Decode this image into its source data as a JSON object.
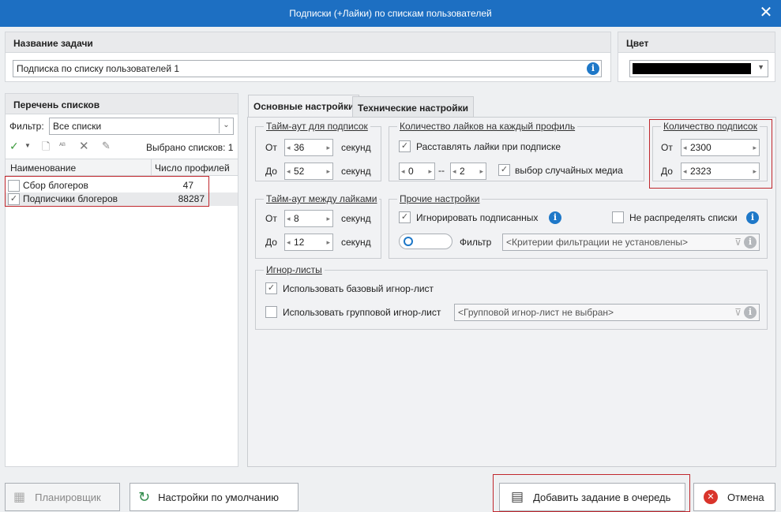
{
  "window": {
    "title": "Подписки (+Лайки) по спискам пользователей"
  },
  "task": {
    "header": "Название задачи",
    "name_value": "Подписка по списку пользователей 1"
  },
  "color": {
    "header": "Цвет",
    "value_color": "#000000"
  },
  "lists": {
    "header": "Перечень списков",
    "filter_label": "Фильтр:",
    "filter_value": "Все списки",
    "selected_label": "Выбрано списков: 1",
    "col_name": "Наименование",
    "col_count": "Число профилей",
    "rows": [
      {
        "name": "Сбор блогеров",
        "count": "47",
        "checked": false
      },
      {
        "name": "Подписчики блогеров",
        "count": "88287",
        "checked": true
      }
    ]
  },
  "tabs": [
    "Основные настройки",
    "Технические настройки"
  ],
  "timeout_subs": {
    "title": "Тайм-аут для подписок",
    "from_label": "От",
    "from_value": "36",
    "to_label": "До",
    "to_value": "52",
    "unit": "секунд"
  },
  "likes": {
    "title": "Количество лайков на каждый профиль",
    "place_likes": "Расставлять лайки при подписке",
    "from_value": "0",
    "dash": "--",
    "to_value": "2",
    "random_media": "выбор случайных медиа"
  },
  "subs_count": {
    "title": "Количество подписок",
    "from_label": "От",
    "from_value": "2300",
    "to_label": "До",
    "to_value": "2323"
  },
  "timeout_likes": {
    "title": "Тайм-аут между лайками",
    "from_label": "От",
    "from_value": "8",
    "to_label": "До",
    "to_value": "12",
    "unit": "секунд"
  },
  "other": {
    "title": "Прочие настройки",
    "ignore_subscribed": "Игнорировать подписанных",
    "no_distribute": "Не распределять списки",
    "filter_label": "Фильтр",
    "filter_placeholder": "<Критерии фильтрации не установлены>"
  },
  "ignore_lists": {
    "title": "Игнор-листы",
    "base": "Использовать базовый игнор-лист",
    "group": "Использовать групповой игнор-лист",
    "group_placeholder": "<Групповой игнор-лист не выбран>"
  },
  "footer": {
    "scheduler": "Планировщик",
    "defaults": "Настройки по умолчанию",
    "add": "Добавить задание в очередь",
    "cancel": "Отмена"
  }
}
